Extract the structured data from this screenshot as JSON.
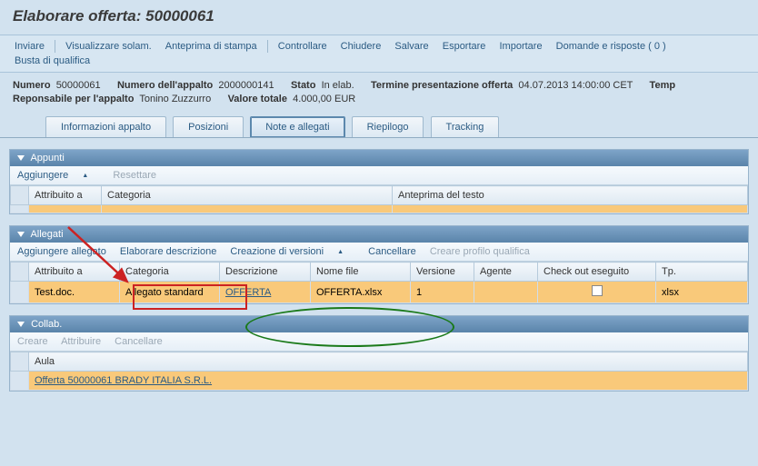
{
  "title": "Elaborare offerta: 50000061",
  "toolbar": {
    "inviare": "Inviare",
    "visualizzare": "Visualizzare solam.",
    "anteprima": "Anteprima di stampa",
    "controllare": "Controllare",
    "chiudere": "Chiudere",
    "salvare": "Salvare",
    "esportare": "Esportare",
    "importare": "Importare",
    "domande": "Domande e risposte ( 0 )",
    "busta": "Busta di qualifica"
  },
  "info": {
    "numero_lbl": "Numero",
    "numero_val": "50000061",
    "numero_appalto_lbl": "Numero dell'appalto",
    "numero_appalto_val": "2000000141",
    "stato_lbl": "Stato",
    "stato_val": "In elab.",
    "termine_lbl": "Termine presentazione offerta",
    "termine_val": "04.07.2013 14:00:00 CET",
    "temp_lbl": "Temp",
    "resp_lbl": "Reponsabile per l'appalto",
    "resp_val": "Tonino Zuzzurro",
    "valtot_lbl": "Valore totale",
    "valtot_val": "4.000,00 EUR"
  },
  "tabs": {
    "info_appalto": "Informazioni appalto",
    "posizioni": "Posizioni",
    "note_allegati": "Note e allegati",
    "riepilogo": "Riepilogo",
    "tracking": "Tracking"
  },
  "appunti": {
    "title": "Appunti",
    "aggiungere": "Aggiungere",
    "resettare": "Resettare",
    "cols": {
      "attribuito": "Attribuito a",
      "categoria": "Categoria",
      "anteprima": "Anteprima del testo"
    }
  },
  "allegati": {
    "title": "Allegati",
    "aggiungere": "Aggiungere allegato",
    "elaborare": "Elaborare descrizione",
    "versioni": "Creazione di versioni",
    "cancellare": "Cancellare",
    "creare_profilo": "Creare profilo qualifica",
    "cols": {
      "attribuito": "Attribuito a",
      "categoria": "Categoria",
      "descrizione": "Descrizione",
      "nomefile": "Nome file",
      "versione": "Versione",
      "agente": "Agente",
      "checkout": "Check out eseguito",
      "tp": "Tp."
    },
    "row": {
      "attribuito": "Test.doc.",
      "categoria": "Allegato standard",
      "descrizione": "OFFERTA",
      "nomefile": "OFFERTA.xlsx",
      "versione": "1",
      "agente": "",
      "tp": "xlsx"
    }
  },
  "collab": {
    "title": "Collab.",
    "creare": "Creare",
    "attribuire": "Attribuire",
    "cancellare": "Cancellare",
    "col_aula": "Aula",
    "row": "Offerta 50000061 BRADY ITALIA S.R.L."
  },
  "chart_data": null
}
